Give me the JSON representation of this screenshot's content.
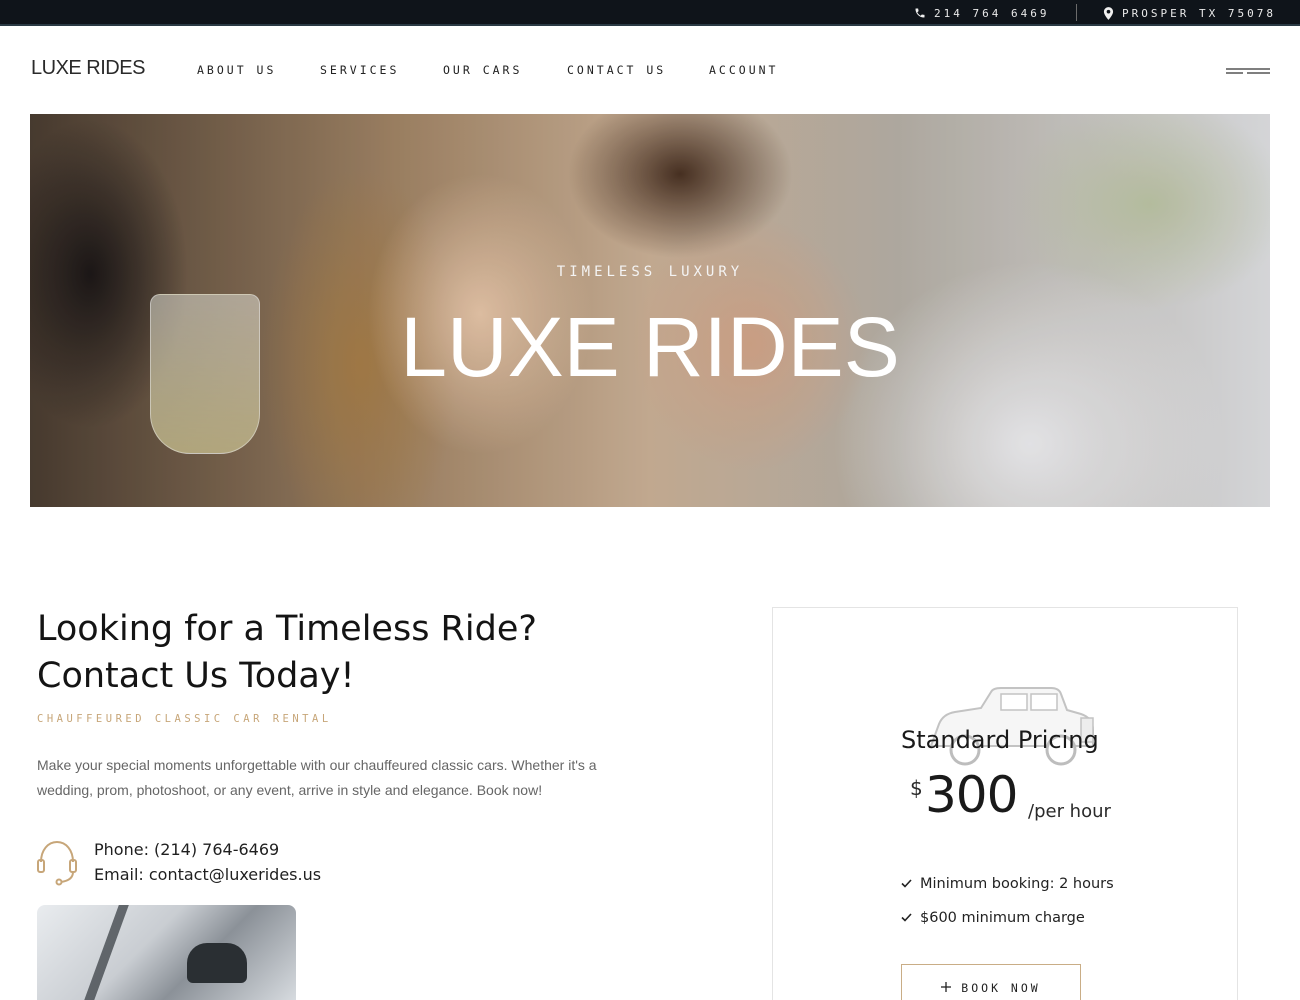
{
  "topbar": {
    "phone": "214 764 6469",
    "location": "PROSPER TX 75078",
    "phone_icon": "phone-icon",
    "location_icon": "map-pin-icon"
  },
  "header": {
    "logo": "LUXE RIDES",
    "nav": {
      "about": "ABOUT US",
      "services": "SERVICES",
      "cars": "OUR CARS",
      "contact": "CONTACT US",
      "account": "ACCOUNT"
    },
    "menu_icon": "menu-icon"
  },
  "hero": {
    "kicker": "TIMELESS LUXURY",
    "title": "LUXE RIDES"
  },
  "contact": {
    "headline_line1": "Looking for a Timeless Ride?",
    "headline_line2": "Contact Us Today!",
    "kicker": "CHAUFFEURED CLASSIC CAR RENTAL",
    "description": "Make your special moments unforgettable with our chauffeured classic cars. Whether it's a wedding, prom, photoshoot, or any event, arrive in style and elegance. Book now!",
    "phone": "Phone: (214) 764-6469",
    "email": "Email: contact@luxerides.us",
    "support_icon": "headset-icon"
  },
  "pricing": {
    "title": "Standard Pricing",
    "currency": "$",
    "amount": "300",
    "unit": "/per hour",
    "features": [
      "Minimum booking: 2 hours",
      "$600 minimum charge"
    ],
    "check_icon": "check-icon",
    "book_label": "BOOK NOW",
    "book_icon": "plus-icon"
  },
  "colors": {
    "accent": "#c7a679",
    "topbar": "#0f141a"
  }
}
